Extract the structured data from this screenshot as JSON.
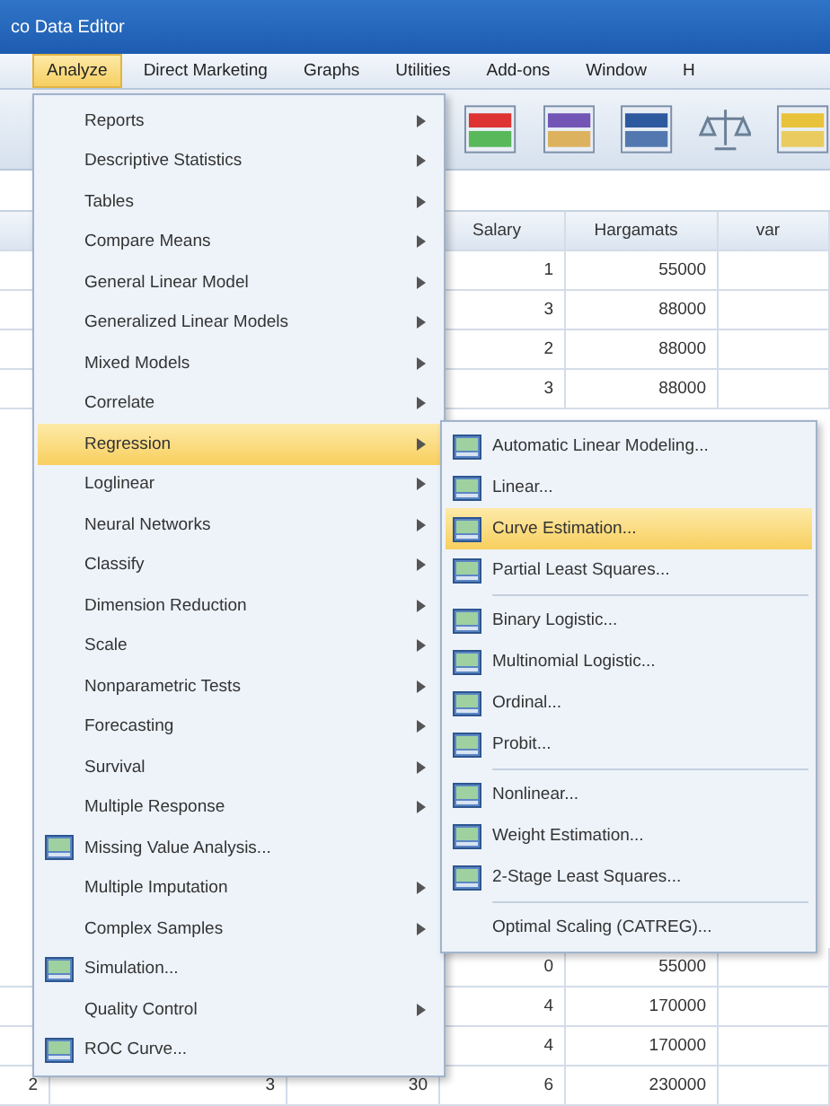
{
  "window": {
    "title": "co Data Editor"
  },
  "menu_bar": [
    {
      "label": "Analyze",
      "selected": true
    },
    {
      "label": "Direct Marketing",
      "selected": false
    },
    {
      "label": "Graphs",
      "selected": false
    },
    {
      "label": "Utilities",
      "selected": false
    },
    {
      "label": "Add-ons",
      "selected": false
    },
    {
      "label": "Window",
      "selected": false
    },
    {
      "label": "H",
      "selected": false
    }
  ],
  "grid": {
    "columns": [
      "Salary",
      "Hargamats",
      "var"
    ],
    "top_rows": [
      {
        "salary": "1",
        "hargamats": "55000"
      },
      {
        "salary": "3",
        "hargamats": "88000"
      },
      {
        "salary": "2",
        "hargamats": "88000"
      },
      {
        "salary": "3",
        "hargamats": "88000"
      }
    ],
    "bottom_rows": [
      {
        "salary": "0",
        "hargamats": "55000"
      },
      {
        "salary": "4",
        "hargamats": "170000"
      },
      {
        "salary": "4",
        "hargamats": "170000"
      },
      {
        "column_1": "2",
        "column_2": "3",
        "column_3": "30",
        "salary": "6",
        "hargamats": "230000"
      }
    ]
  },
  "analyze_menu": [
    {
      "kind": "submenu",
      "label": "Reports",
      "selected": false
    },
    {
      "kind": "submenu",
      "label": "Descriptive Statistics",
      "selected": false
    },
    {
      "kind": "submenu",
      "label": "Tables",
      "selected": false
    },
    {
      "kind": "submenu",
      "label": "Compare Means",
      "selected": false
    },
    {
      "kind": "submenu",
      "label": "General Linear Model",
      "selected": false
    },
    {
      "kind": "submenu",
      "label": "Generalized Linear Models",
      "selected": false
    },
    {
      "kind": "submenu",
      "label": "Mixed Models",
      "selected": false
    },
    {
      "kind": "submenu",
      "label": "Correlate",
      "selected": false
    },
    {
      "kind": "submenu",
      "label": "Regression",
      "selected": true
    },
    {
      "kind": "submenu",
      "label": "Loglinear",
      "selected": false
    },
    {
      "kind": "submenu",
      "label": "Neural Networks",
      "selected": false
    },
    {
      "kind": "submenu",
      "label": "Classify",
      "selected": false
    },
    {
      "kind": "submenu",
      "label": "Dimension Reduction",
      "selected": false
    },
    {
      "kind": "submenu",
      "label": "Scale",
      "selected": false
    },
    {
      "kind": "submenu",
      "label": "Nonparametric Tests",
      "selected": false
    },
    {
      "kind": "submenu",
      "label": "Forecasting",
      "selected": false
    },
    {
      "kind": "submenu",
      "label": "Survival",
      "selected": false
    },
    {
      "kind": "submenu",
      "label": "Multiple Response",
      "selected": false
    },
    {
      "kind": "command",
      "label": "Missing Value Analysis...",
      "selected": false
    },
    {
      "kind": "submenu",
      "label": "Multiple Imputation",
      "selected": false
    },
    {
      "kind": "submenu",
      "label": "Complex Samples",
      "selected": false
    },
    {
      "kind": "command",
      "label": "Simulation...",
      "selected": false
    },
    {
      "kind": "submenu",
      "label": "Quality Control",
      "selected": false
    },
    {
      "kind": "command",
      "label": "ROC Curve...",
      "selected": false
    }
  ],
  "regression_menu": [
    {
      "kind": "command",
      "label": "Automatic Linear Modeling...",
      "selected": false
    },
    {
      "kind": "command",
      "label": "Linear...",
      "selected": false
    },
    {
      "kind": "command",
      "label": "Curve Estimation...",
      "selected": true
    },
    {
      "kind": "command",
      "label": "Partial Least Squares...",
      "selected": false
    },
    {
      "kind": "separator"
    },
    {
      "kind": "command",
      "label": "Binary Logistic...",
      "selected": false
    },
    {
      "kind": "command",
      "label": "Multinomial Logistic...",
      "selected": false
    },
    {
      "kind": "command",
      "label": "Ordinal...",
      "selected": false
    },
    {
      "kind": "command",
      "label": "Probit...",
      "selected": false
    },
    {
      "kind": "separator"
    },
    {
      "kind": "command",
      "label": "Nonlinear...",
      "selected": false
    },
    {
      "kind": "command",
      "label": "Weight Estimation...",
      "selected": false
    },
    {
      "kind": "command",
      "label": "2-Stage Least Squares...",
      "selected": false
    },
    {
      "kind": "separator"
    },
    {
      "kind": "plain",
      "label": "Optimal Scaling (CATREG)...",
      "selected": false
    }
  ]
}
